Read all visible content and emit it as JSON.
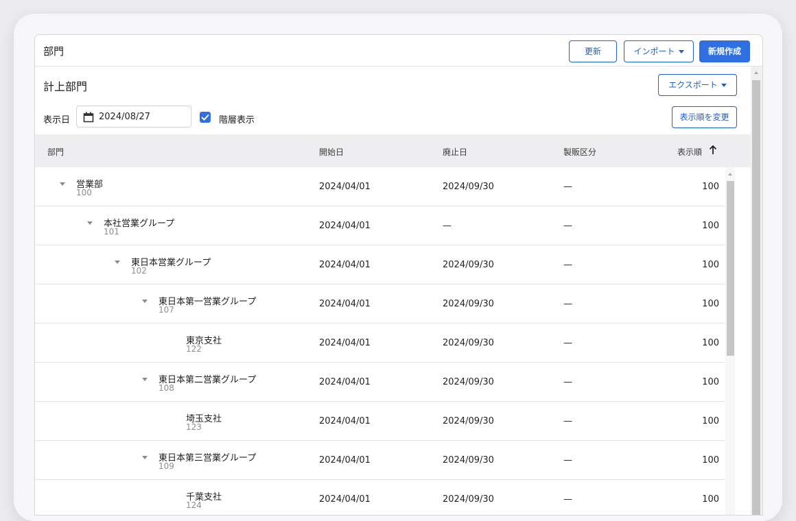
{
  "header": {
    "title": "部門",
    "refresh_label": "更新",
    "import_label": "インポート",
    "new_label": "新規作成"
  },
  "section": {
    "title": "計上部門",
    "export_label": "エクスポート",
    "change_order_label": "表示順を変更"
  },
  "filters": {
    "date_label": "表示日",
    "date_value": "2024/08/27",
    "hierarchy_label": "階層表示",
    "hierarchy_checked": true
  },
  "table": {
    "columns": {
      "department": "部門",
      "start_date": "開始日",
      "end_date": "廃止日",
      "sales_category": "製販区分",
      "display_order": "表示順"
    },
    "rows": [
      {
        "name": "営業部",
        "code": "100",
        "start": "2024/04/01",
        "end": "2024/09/30",
        "category": "—",
        "order": "100",
        "depth": 0,
        "expandable": true
      },
      {
        "name": "本社営業グループ",
        "code": "101",
        "start": "2024/04/01",
        "end": "—",
        "category": "—",
        "order": "100",
        "depth": 1,
        "expandable": true
      },
      {
        "name": "東日本営業グループ",
        "code": "102",
        "start": "2024/04/01",
        "end": "2024/09/30",
        "category": "—",
        "order": "100",
        "depth": 2,
        "expandable": true
      },
      {
        "name": "東日本第一営業グループ",
        "code": "107",
        "start": "2024/04/01",
        "end": "2024/09/30",
        "category": "—",
        "order": "100",
        "depth": 3,
        "expandable": true
      },
      {
        "name": "東京支社",
        "code": "122",
        "start": "2024/04/01",
        "end": "2024/09/30",
        "category": "—",
        "order": "100",
        "depth": 4,
        "expandable": false
      },
      {
        "name": "東日本第二営業グループ",
        "code": "108",
        "start": "2024/04/01",
        "end": "2024/09/30",
        "category": "—",
        "order": "100",
        "depth": 3,
        "expandable": true
      },
      {
        "name": "埼玉支社",
        "code": "123",
        "start": "2024/04/01",
        "end": "2024/09/30",
        "category": "—",
        "order": "100",
        "depth": 4,
        "expandable": false
      },
      {
        "name": "東日本第三営業グループ",
        "code": "109",
        "start": "2024/04/01",
        "end": "2024/09/30",
        "category": "—",
        "order": "100",
        "depth": 3,
        "expandable": true
      },
      {
        "name": "千葉支社",
        "code": "124",
        "start": "2024/04/01",
        "end": "2024/09/30",
        "category": "—",
        "order": "100",
        "depth": 4,
        "expandable": false
      }
    ]
  },
  "colors": {
    "accent": "#2f6fe0",
    "border_accent": "#1f5fc8"
  }
}
